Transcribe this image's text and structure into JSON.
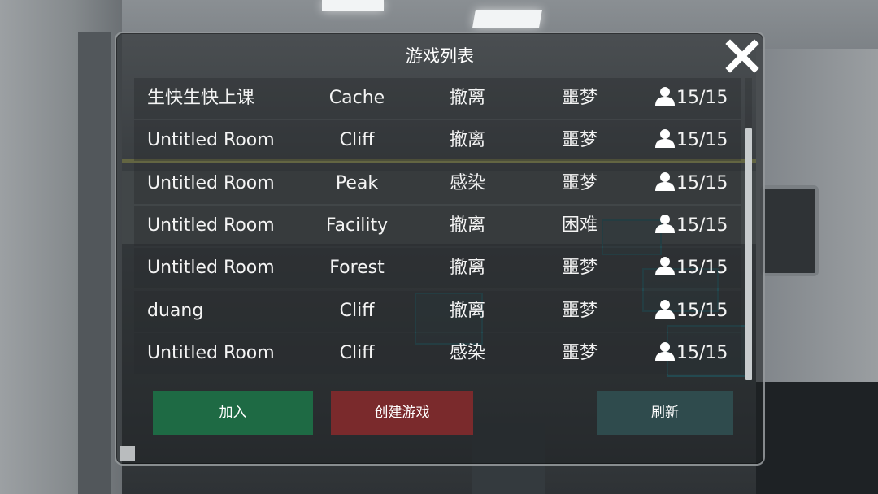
{
  "dialog": {
    "title": "游戏列表",
    "close_icon": "close-x-icon"
  },
  "rooms": [
    {
      "name": "生快生快上课",
      "map": "Cache",
      "mode": "撤离",
      "difficulty": "噩梦",
      "players": "15/15"
    },
    {
      "name": "Untitled Room",
      "map": "Cliff",
      "mode": "撤离",
      "difficulty": "噩梦",
      "players": "15/15"
    },
    {
      "name": "Untitled Room",
      "map": "Peak",
      "mode": "感染",
      "difficulty": "噩梦",
      "players": "15/15"
    },
    {
      "name": "Untitled Room",
      "map": "Facility",
      "mode": "撤离",
      "difficulty": "困难",
      "players": "15/15"
    },
    {
      "name": "Untitled Room",
      "map": "Forest",
      "mode": "撤离",
      "difficulty": "噩梦",
      "players": "15/15"
    },
    {
      "name": "duang",
      "map": "Cliff",
      "mode": "撤离",
      "difficulty": "噩梦",
      "players": "15/15"
    },
    {
      "name": "Untitled Room",
      "map": "Cliff",
      "mode": "感染",
      "difficulty": "噩梦",
      "players": "15/15"
    }
  ],
  "player_icon": "user-icon",
  "buttons": {
    "join": "加入",
    "create": "创建游戏",
    "refresh": "刷新"
  },
  "colors": {
    "join": "#1e6a44",
    "create": "#7a2a2c",
    "refresh": "#2f4b4d"
  }
}
